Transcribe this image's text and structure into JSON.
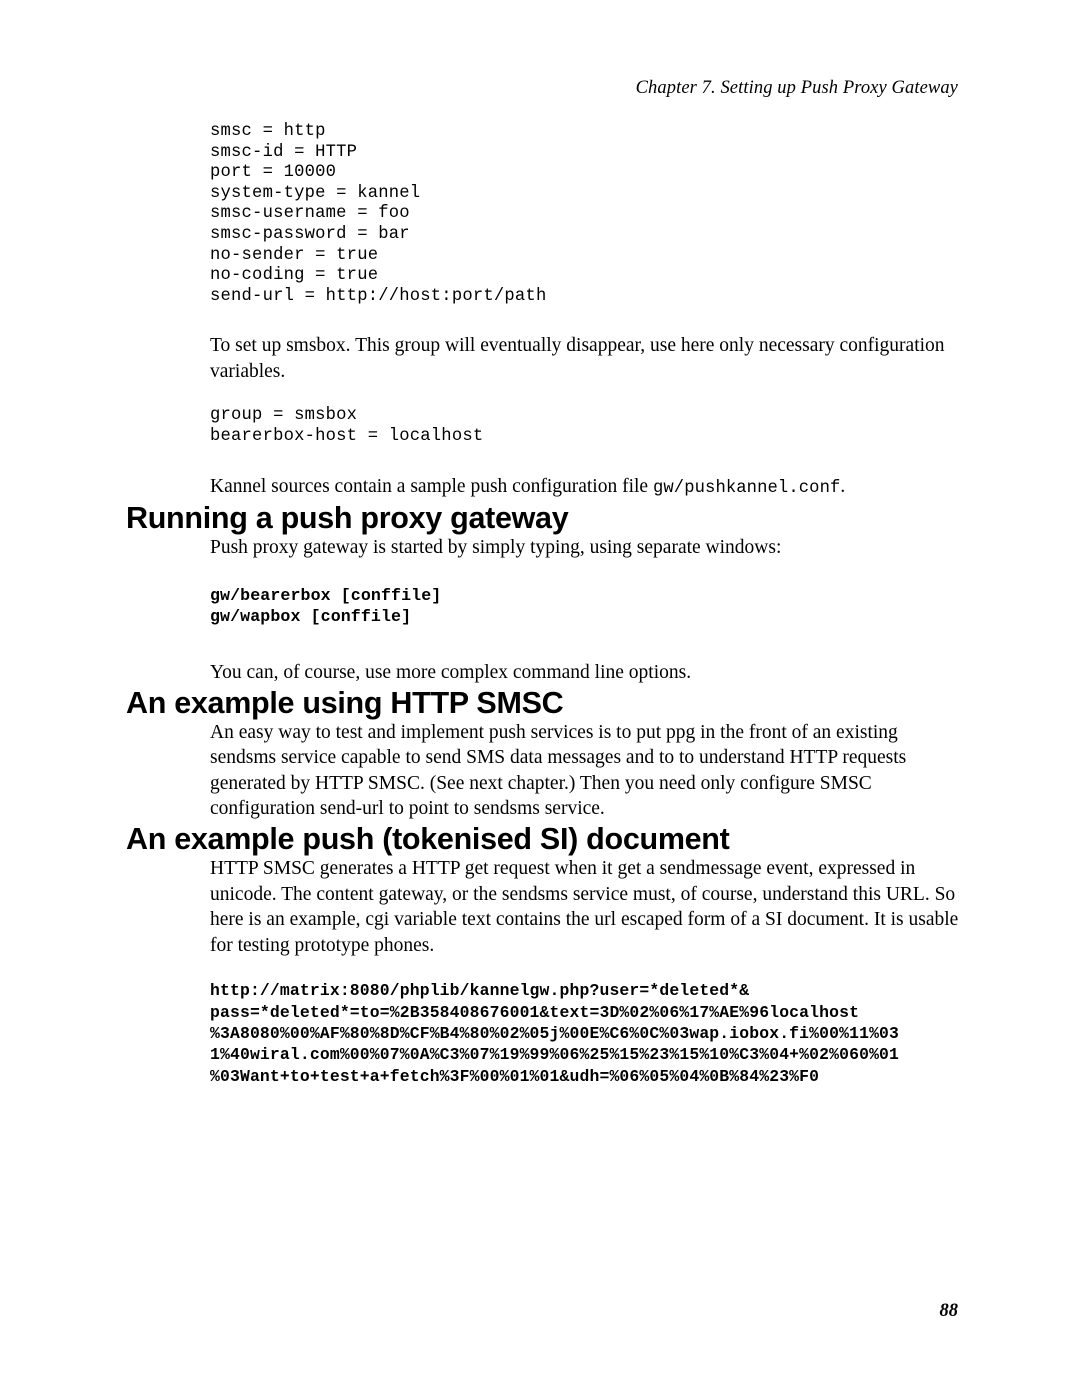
{
  "header": {
    "chapter_title": "Chapter 7. Setting up Push Proxy Gateway"
  },
  "footer": {
    "page_number": "88"
  },
  "content": {
    "smsc_config_block": "smsc = http\nsmsc-id = HTTP\nport = 10000\nsystem-type = kannel\nsmsc-username = foo\nsmsc-password = bar\nno-sender = true\nno-coding = true\nsend-url = http://host:port/path",
    "smsbox_intro": "To set up smsbox. This group will eventually disappear, use here only necessary configuration variables.",
    "smsbox_config_block": "group = smsbox\nbearerbox-host = localhost",
    "sample_conf_text_before": "Kannel sources contain a sample push configuration file ",
    "sample_conf_file": "gw/pushkannel.conf",
    "sample_conf_text_after": ".",
    "heading_running": "Running a push proxy gateway",
    "running_intro": "Push proxy gateway is started by simply typing, using separate windows:",
    "run_commands_block": "gw/bearerbox [conffile]\ngw/wapbox [conffile]",
    "running_outro": "You can, of course, use more complex command line options.",
    "heading_http_smsc": "An example using HTTP SMSC",
    "http_smsc_paragraph": "An easy way to test and implement push services is to put ppg in the front of an existing sendsms service capable to send SMS data messages and to to understand HTTP requests generated by HTTP SMSC. (See next chapter.) Then you need only configure SMSC configuration send-url to point to sendsms service.",
    "heading_tokenised_si": "An example push (tokenised SI) document",
    "tokenised_si_paragraph": "HTTP SMSC generates a HTTP get request when it get a sendmessage event, expressed in unicode. The content gateway, or the sendsms service must, of course, understand this URL. So here is an example, cgi variable text contains the url escaped form of a SI document. It is usable for testing prototype phones.",
    "si_url_block": "http://matrix:8080/phplib/kannelgw.php?user=*deleted*&\npass=*deleted*=to=%2B358408676001&text=3D%02%06%17%AE%96localhost\n%3A8080%00%AF%80%8D%CF%B4%80%02%05j%00E%C6%0C%03wap.iobox.fi%00%11%03\n1%40wiral.com%00%07%0A%C3%07%19%99%06%25%15%23%15%10%C3%04+%02%060%01\n%03Want+to+test+a+fetch%3F%00%01%01&udh=%06%05%04%0B%84%23%F0"
  }
}
